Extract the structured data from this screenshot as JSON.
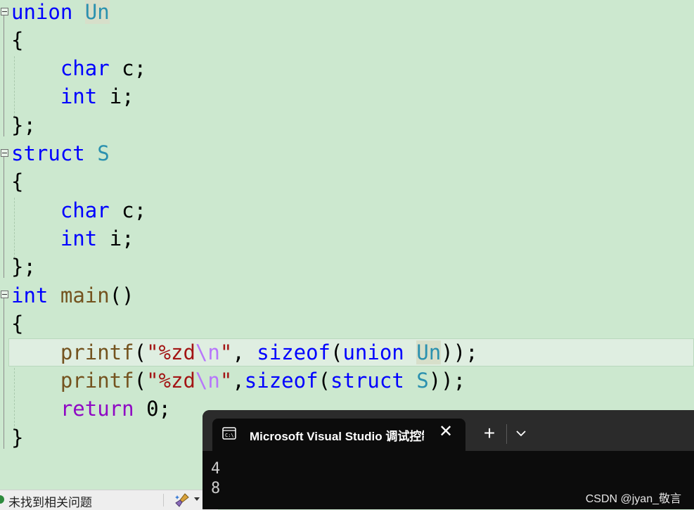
{
  "code": {
    "l1": [
      "union",
      " ",
      "Un"
    ],
    "l2": "{",
    "l3": [
      "char",
      " c;"
    ],
    "l4": [
      "int",
      " i;"
    ],
    "l5": "};",
    "l6": [
      "struct",
      " ",
      "S"
    ],
    "l7": "{",
    "l8": [
      "char",
      " c;"
    ],
    "l9": [
      "int",
      " i;"
    ],
    "l10": "};",
    "l11": [
      "int",
      " ",
      "main",
      "()"
    ],
    "l12": "{",
    "l13": [
      "printf",
      "(",
      "\"%zd",
      "\\n",
      "\"",
      ", ",
      "sizeof",
      "(",
      "union",
      " ",
      "Un",
      "));"
    ],
    "l14": [
      "printf",
      "(",
      "\"%zd",
      "\\n",
      "\"",
      ",",
      "sizeof",
      "(",
      "struct",
      " ",
      "S",
      "));"
    ],
    "l15": [
      "return",
      " 0;"
    ],
    "l16": "}"
  },
  "statusbar": {
    "message": "未找到相关问题"
  },
  "terminal": {
    "tab_title": "Microsoft Visual Studio 调试控制台",
    "close_glyph": "✕",
    "new_tab_glyph": "+",
    "output": "4\n8",
    "watermark": "CSDN @jyan_敬言"
  },
  "colors": {
    "editor_bg": "#cce8cf",
    "keyword": "#0000ff",
    "type_name": "#2b91af",
    "function": "#74531f",
    "string": "#a31515",
    "escape": "#b776fb",
    "control_keyword": "#8f08c4"
  },
  "icons": [
    "fold-minus-icon",
    "cleanup-brush-icon",
    "console-icon",
    "close-icon",
    "plus-icon",
    "chevron-down-icon",
    "status-ok-icon"
  ]
}
